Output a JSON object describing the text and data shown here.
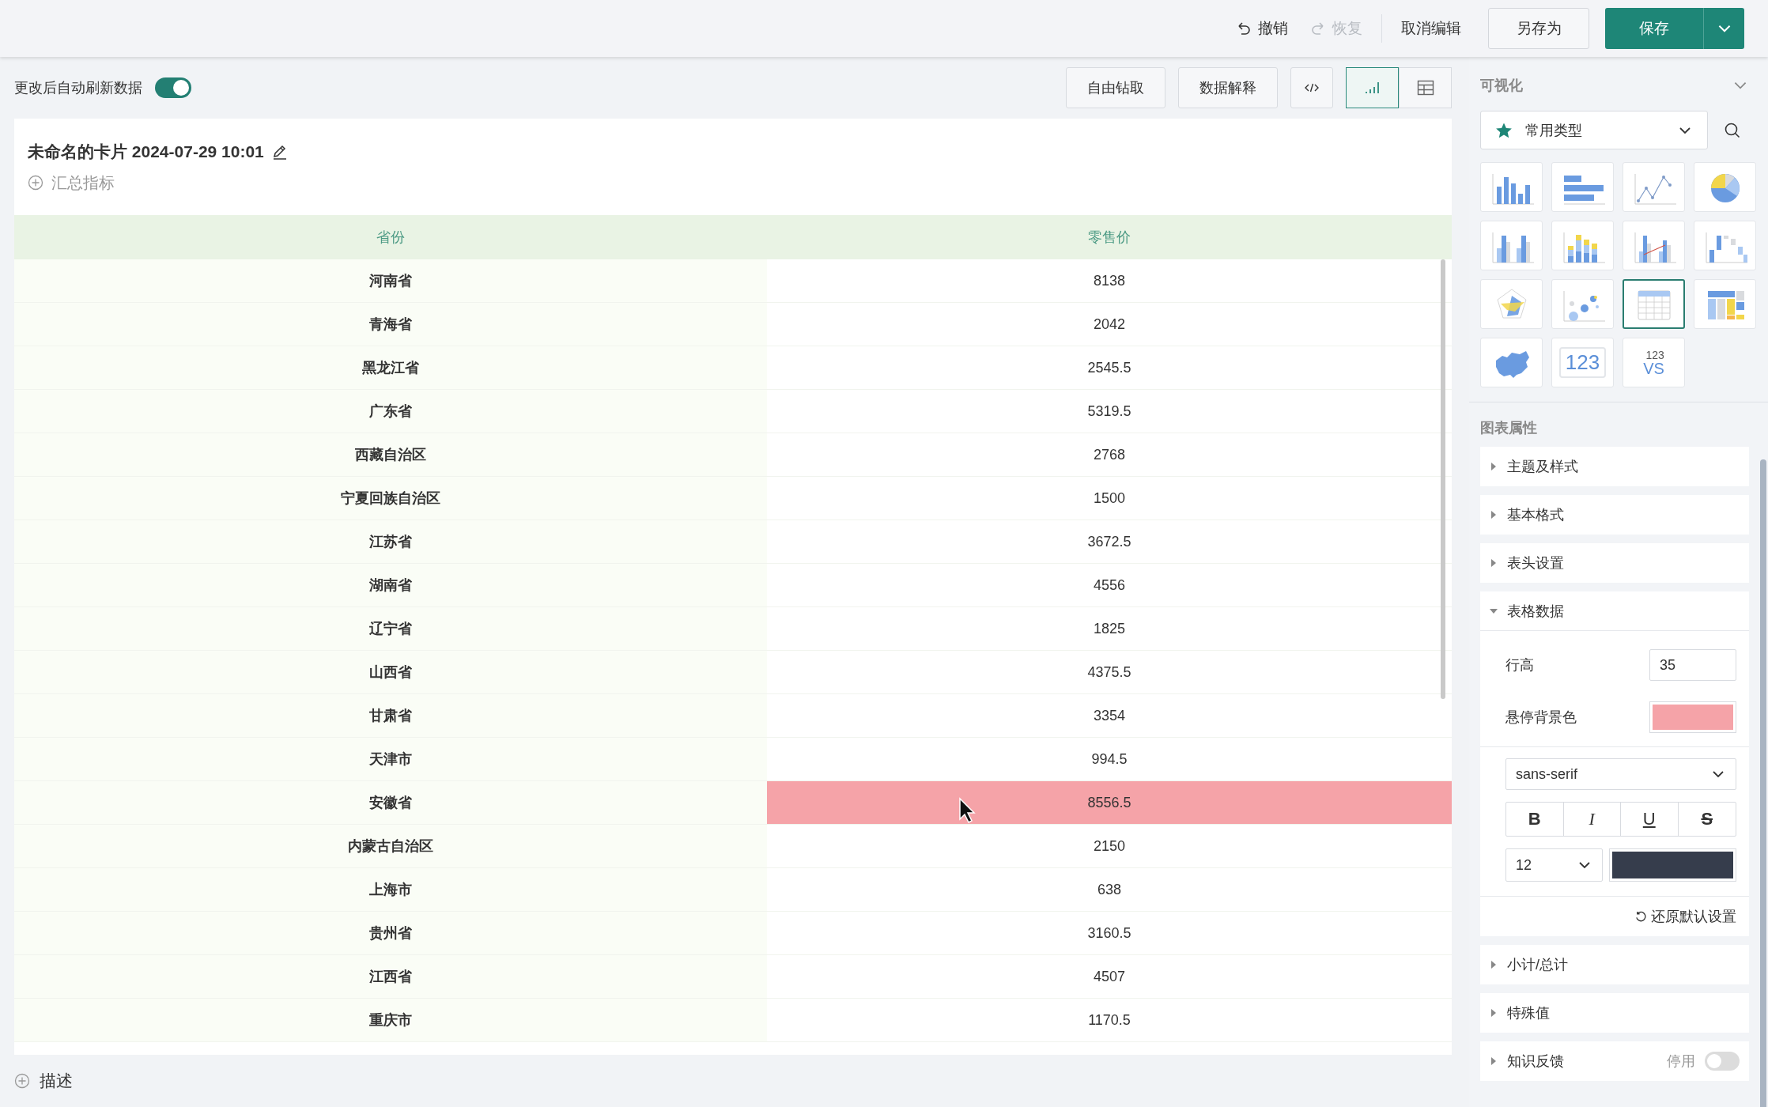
{
  "toolbar": {
    "undo": "撤销",
    "redo": {
      "label": "恢复",
      "disabled": true
    },
    "cancel": "取消编辑",
    "save_as": "另存为",
    "save": "保存"
  },
  "auto_refresh": {
    "label": "更改后自动刷新数据",
    "on": true
  },
  "view_buttons": [
    "自由钻取",
    "数据解释"
  ],
  "view_modes": [
    {
      "kind": "chart",
      "selected": true
    },
    {
      "kind": "table",
      "selected": false
    }
  ],
  "card": {
    "title": "未命名的卡片 2024-07-29 10:01",
    "add_metric": "汇总指标"
  },
  "table": {
    "columns": [
      "省份",
      "零售价"
    ],
    "rows": [
      {
        "cells": [
          "河南省",
          "8138"
        ],
        "hovered": false
      },
      {
        "cells": [
          "青海省",
          "2042"
        ],
        "hovered": false
      },
      {
        "cells": [
          "黑龙江省",
          "2545.5"
        ],
        "hovered": false
      },
      {
        "cells": [
          "广东省",
          "5319.5"
        ],
        "hovered": false
      },
      {
        "cells": [
          "西藏自治区",
          "2768"
        ],
        "hovered": false
      },
      {
        "cells": [
          "宁夏回族自治区",
          "1500"
        ],
        "hovered": false
      },
      {
        "cells": [
          "江苏省",
          "3672.5"
        ],
        "hovered": false
      },
      {
        "cells": [
          "湖南省",
          "4556"
        ],
        "hovered": false
      },
      {
        "cells": [
          "辽宁省",
          "1825"
        ],
        "hovered": false
      },
      {
        "cells": [
          "山西省",
          "4375.5"
        ],
        "hovered": false
      },
      {
        "cells": [
          "甘肃省",
          "3354"
        ],
        "hovered": false
      },
      {
        "cells": [
          "天津市",
          "994.5"
        ],
        "hovered": false
      },
      {
        "cells": [
          "安徽省",
          "8556.5"
        ],
        "hovered": true
      },
      {
        "cells": [
          "内蒙古自治区",
          "2150"
        ],
        "hovered": false
      },
      {
        "cells": [
          "上海市",
          "638"
        ],
        "hovered": false
      },
      {
        "cells": [
          "贵州省",
          "3160.5"
        ],
        "hovered": false
      },
      {
        "cells": [
          "江西省",
          "4507"
        ],
        "hovered": false
      },
      {
        "cells": [
          "重庆市",
          "1170.5"
        ],
        "hovered": false
      }
    ]
  },
  "description": "描述",
  "panel": {
    "title": "可视化",
    "category": "常用类型",
    "chart_types": [
      {
        "kind": "column",
        "selected": false
      },
      {
        "kind": "bar",
        "selected": false
      },
      {
        "kind": "line",
        "selected": false
      },
      {
        "kind": "pie",
        "selected": false
      },
      {
        "kind": "grouped",
        "selected": false
      },
      {
        "kind": "stacked",
        "selected": false
      },
      {
        "kind": "combo",
        "selected": false
      },
      {
        "kind": "waterfall",
        "selected": false
      },
      {
        "kind": "radar",
        "selected": false
      },
      {
        "kind": "bubble",
        "selected": false
      },
      {
        "kind": "table",
        "selected": true
      },
      {
        "kind": "treemap",
        "selected": false
      },
      {
        "kind": "map",
        "selected": false
      },
      {
        "kind": "kpi",
        "labels": [
          "123"
        ],
        "selected": false
      },
      {
        "kind": "compare",
        "labels": [
          "123",
          "VS"
        ],
        "selected": false
      }
    ]
  },
  "properties": {
    "title": "图表属性",
    "sections": [
      {
        "label": "主题及样式",
        "expanded": false
      },
      {
        "label": "基本格式",
        "expanded": false
      },
      {
        "label": "表头设置",
        "expanded": false
      },
      {
        "label": "表格数据",
        "expanded": true,
        "settings": {
          "row_height": {
            "label": "行高",
            "value": "35"
          },
          "hover_color": {
            "label": "悬停背景色",
            "color": "#f5a3a8"
          },
          "font": "sans-serif",
          "styles": [
            {
              "kind": "bold",
              "label": "B"
            },
            {
              "kind": "italic",
              "label": "I"
            },
            {
              "kind": "underline",
              "label": "U"
            },
            {
              "kind": "strike",
              "label": "S"
            }
          ],
          "font_size": "12",
          "font_color": {
            "color": "#363d4c"
          },
          "reset": "还原默认设置"
        }
      },
      {
        "label": "小计/总计",
        "expanded": false
      },
      {
        "label": "特殊值",
        "expanded": false
      },
      {
        "label": "知识反馈",
        "expanded": false,
        "toggle": {
          "label": "停用",
          "on": false
        }
      }
    ]
  }
}
